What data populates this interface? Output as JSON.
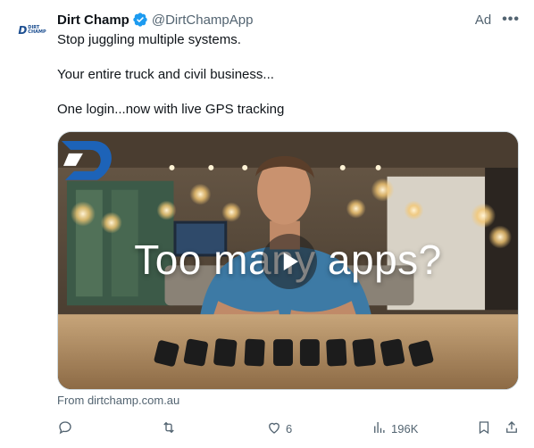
{
  "post": {
    "author_name": "Dirt Champ",
    "handle": "@DirtChampApp",
    "ad_label": "Ad",
    "more_label": "•••",
    "avatar_text_line1": "DIRT",
    "avatar_text_line2": "CHAMP",
    "avatar_letter": "D",
    "paragraphs": [
      "Stop juggling multiple systems.",
      "Your entire truck and civil business...",
      "One login...now with live GPS tracking"
    ],
    "media": {
      "overlay_text": "Too many apps?",
      "icon": "play-icon"
    },
    "source": "From dirtchamp.com.au",
    "actions": {
      "reply": {
        "icon": "reply-icon",
        "count": ""
      },
      "repost": {
        "icon": "repost-icon",
        "count": ""
      },
      "like": {
        "icon": "heart-icon",
        "count": "6"
      },
      "views": {
        "icon": "views-icon",
        "count": "196K"
      },
      "bookmark": {
        "icon": "bookmark-icon"
      },
      "share": {
        "icon": "share-icon"
      }
    }
  },
  "colors": {
    "text_primary": "#0f1419",
    "text_secondary": "#536471",
    "verified": "#1d9bf0",
    "brand_blue": "#1d4f91"
  }
}
